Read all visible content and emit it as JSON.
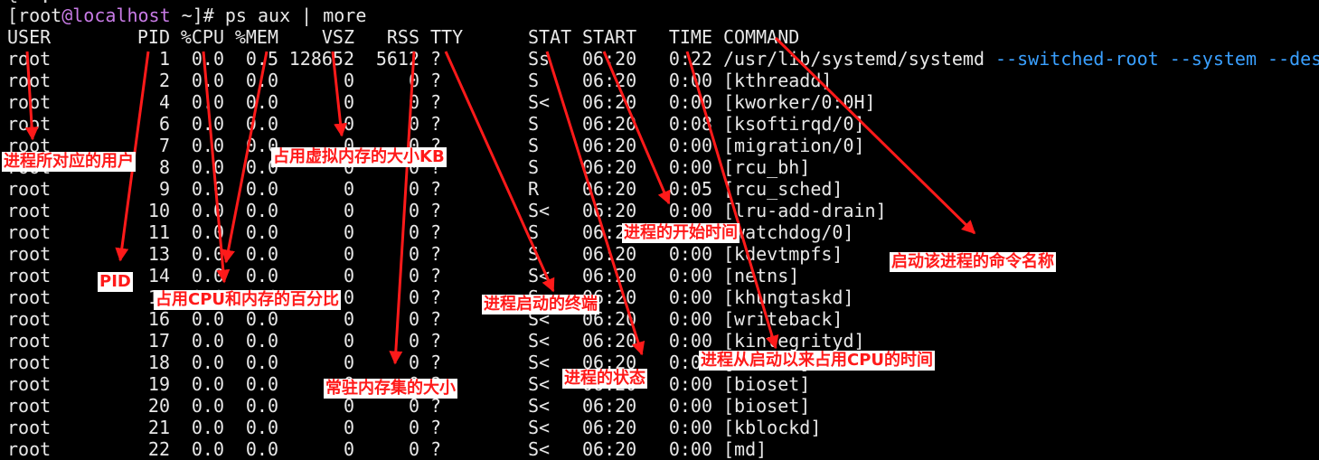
{
  "terminal": {
    "top_partial": "l  .   ",
    "prompt": {
      "open": "[",
      "user": "root",
      "at": "@",
      "host": "localhost",
      "path_close": " ~]# ",
      "command": "ps aux | more"
    },
    "header": {
      "user": "USER",
      "pid": "PID",
      "cpu": "%CPU",
      "mem": "%MEM",
      "vsz": "VSZ",
      "rss": "RSS",
      "tty": "TTY",
      "stat": "STAT",
      "start": "START",
      "time": "TIME",
      "command": "COMMAND"
    },
    "rows": [
      {
        "user": "root",
        "pid": "1",
        "cpu": "0.0",
        "mem": "0.5",
        "vsz": "128652",
        "rss": "5612",
        "tty": "?",
        "stat": "Ss",
        "start": "06:20",
        "time": "0:22",
        "command": "/usr/lib/systemd/systemd",
        "args": "--switched-root --system --des"
      },
      {
        "user": "root",
        "pid": "2",
        "cpu": "0.0",
        "mem": "0.0",
        "vsz": "0",
        "rss": "0",
        "tty": "?",
        "stat": "S",
        "start": "06:20",
        "time": "0:00",
        "command": "[kthreadd]",
        "args": ""
      },
      {
        "user": "root",
        "pid": "4",
        "cpu": "0.0",
        "mem": "0.0",
        "vsz": "0",
        "rss": "0",
        "tty": "?",
        "stat": "S<",
        "start": "06:20",
        "time": "0:00",
        "command": "[kworker/0:0H]",
        "args": ""
      },
      {
        "user": "root",
        "pid": "6",
        "cpu": "0.0",
        "mem": "0.0",
        "vsz": "0",
        "rss": "0",
        "tty": "?",
        "stat": "S",
        "start": "06:20",
        "time": "0:08",
        "command": "[ksoftirqd/0]",
        "args": ""
      },
      {
        "user": "root",
        "pid": "7",
        "cpu": "0.0",
        "mem": "0.0",
        "vsz": "0",
        "rss": "0",
        "tty": "?",
        "stat": "S",
        "start": "06:20",
        "time": "0:00",
        "command": "[migration/0]",
        "args": ""
      },
      {
        "user": "root",
        "pid": "8",
        "cpu": "0.0",
        "mem": "0.0",
        "vsz": "0",
        "rss": "0",
        "tty": "?",
        "stat": "S",
        "start": "06:20",
        "time": "0:00",
        "command": "[rcu_bh]",
        "args": ""
      },
      {
        "user": "root",
        "pid": "9",
        "cpu": "0.0",
        "mem": "0.0",
        "vsz": "0",
        "rss": "0",
        "tty": "?",
        "stat": "R",
        "start": "06:20",
        "time": "0:05",
        "command": "[rcu_sched]",
        "args": ""
      },
      {
        "user": "root",
        "pid": "10",
        "cpu": "0.0",
        "mem": "0.0",
        "vsz": "0",
        "rss": "0",
        "tty": "?",
        "stat": "S<",
        "start": "06:20",
        "time": "0:00",
        "command": "[lru-add-drain]",
        "args": ""
      },
      {
        "user": "root",
        "pid": "11",
        "cpu": "0.0",
        "mem": "0.0",
        "vsz": "0",
        "rss": "0",
        "tty": "?",
        "stat": "S",
        "start": "06:20",
        "time": "0:00",
        "command": "[watchdog/0]",
        "args": ""
      },
      {
        "user": "root",
        "pid": "13",
        "cpu": "0.0",
        "mem": "0.0",
        "vsz": "0",
        "rss": "0",
        "tty": "?",
        "stat": "S",
        "start": "06:20",
        "time": "0:00",
        "command": "[kdevtmpfs]",
        "args": ""
      },
      {
        "user": "root",
        "pid": "14",
        "cpu": "0.0",
        "mem": "0.0",
        "vsz": "0",
        "rss": "0",
        "tty": "?",
        "stat": "S<",
        "start": "06:20",
        "time": "0:00",
        "command": "[netns]",
        "args": ""
      },
      {
        "user": "root",
        "pid": "15",
        "cpu": "0.0",
        "mem": "0.0",
        "vsz": "0",
        "rss": "0",
        "tty": "?",
        "stat": "S",
        "start": "06:20",
        "time": "0:00",
        "command": "[khungtaskd]",
        "args": ""
      },
      {
        "user": "root",
        "pid": "16",
        "cpu": "0.0",
        "mem": "0.0",
        "vsz": "0",
        "rss": "0",
        "tty": "?",
        "stat": "S<",
        "start": "06:20",
        "time": "0:00",
        "command": "[writeback]",
        "args": ""
      },
      {
        "user": "root",
        "pid": "17",
        "cpu": "0.0",
        "mem": "0.0",
        "vsz": "0",
        "rss": "0",
        "tty": "?",
        "stat": "S<",
        "start": "06:20",
        "time": "0:00",
        "command": "[kintegrityd]",
        "args": ""
      },
      {
        "user": "root",
        "pid": "18",
        "cpu": "0.0",
        "mem": "0.0",
        "vsz": "0",
        "rss": "0",
        "tty": "?",
        "stat": "S<",
        "start": "06:20",
        "time": "0:00",
        "command": "[bioset]",
        "args": ""
      },
      {
        "user": "root",
        "pid": "19",
        "cpu": "0.0",
        "mem": "0.0",
        "vsz": "0",
        "rss": "0",
        "tty": "?",
        "stat": "S<",
        "start": "06:20",
        "time": "0:00",
        "command": "[bioset]",
        "args": ""
      },
      {
        "user": "root",
        "pid": "20",
        "cpu": "0.0",
        "mem": "0.0",
        "vsz": "0",
        "rss": "0",
        "tty": "?",
        "stat": "S<",
        "start": "06:20",
        "time": "0:00",
        "command": "[bioset]",
        "args": ""
      },
      {
        "user": "root",
        "pid": "21",
        "cpu": "0.0",
        "mem": "0.0",
        "vsz": "0",
        "rss": "0",
        "tty": "?",
        "stat": "S<",
        "start": "06:20",
        "time": "0:00",
        "command": "[kblockd]",
        "args": ""
      },
      {
        "user": "root",
        "pid": "22",
        "cpu": "0.0",
        "mem": "0.0",
        "vsz": "0",
        "rss": "0",
        "tty": "?",
        "stat": "S<",
        "start": "06:20",
        "time": "0:00",
        "command": "[md]",
        "args": ""
      }
    ]
  },
  "annotations": {
    "user": "进程所对应的用户",
    "pid": "PID",
    "cpu_mem": "占用CPU和内存的百分比",
    "vsz": "占用虚拟内存的大小KB",
    "rss": "常驻内存集的大小",
    "tty": "进程启动的终端",
    "stat": "进程的状态",
    "start": "进程的开始时间",
    "time": "进程从启动以来占用CPU的时间",
    "command": "启动该进程的命令名称"
  },
  "colors": {
    "background": "#000000",
    "text": "#e8e8e8",
    "host": "#c87be6",
    "args": "#3aa0ff",
    "annotation": "#ff1a1a"
  }
}
